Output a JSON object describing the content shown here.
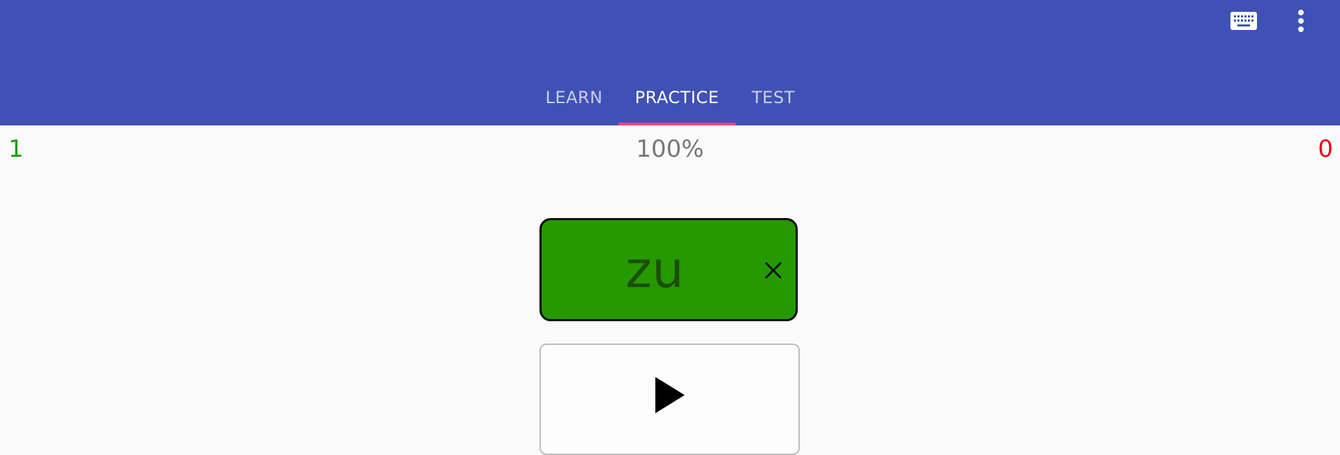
{
  "app": {
    "accent_color": "#3f51b5",
    "indicator_color": "#ff4081"
  },
  "toolbar": {
    "keyboard_icon": "keyboard-icon",
    "more_icon": "more-vert-icon"
  },
  "tabs": [
    {
      "label": "LEARN",
      "active": false
    },
    {
      "label": "PRACTICE",
      "active": true
    },
    {
      "label": "TEST",
      "active": false
    }
  ],
  "stats": {
    "correct": "1",
    "percent": "100%",
    "wrong": "0",
    "correct_color": "#1f9a09",
    "wrong_color": "#e8001c"
  },
  "answer": {
    "word": "zu",
    "tile_color": "#259a00",
    "clear_icon": "close-icon"
  },
  "player": {
    "play_icon": "play-icon"
  }
}
